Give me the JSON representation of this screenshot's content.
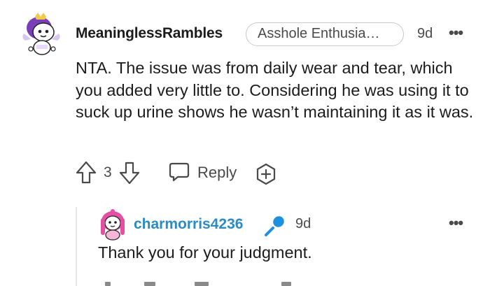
{
  "top_comment": {
    "username": "MeaninglessRambles",
    "flair": "Asshole Enthusia…",
    "time": "9d",
    "more": "•••",
    "body": "NTA. The issue was from daily wear and tear, which you added very little to. Considering he was using it to suck up urine shows he wasn’t maintaining it as it was.",
    "score": "3",
    "reply_label": "Reply",
    "avatar_icon": "snoo-avatar-purple-winged"
  },
  "reply_comment": {
    "username": "charmorris4236",
    "time": "9d",
    "more": "•••",
    "body": "Thank you for your judgment.",
    "avatar_icon": "snoo-avatar-pink",
    "badge_icon": "microphone-icon"
  },
  "colors": {
    "username_link": "#2a8cc6",
    "text": "#1c1c1c",
    "meta": "#4a4a4a",
    "mic_blue": "#1e90e0"
  }
}
